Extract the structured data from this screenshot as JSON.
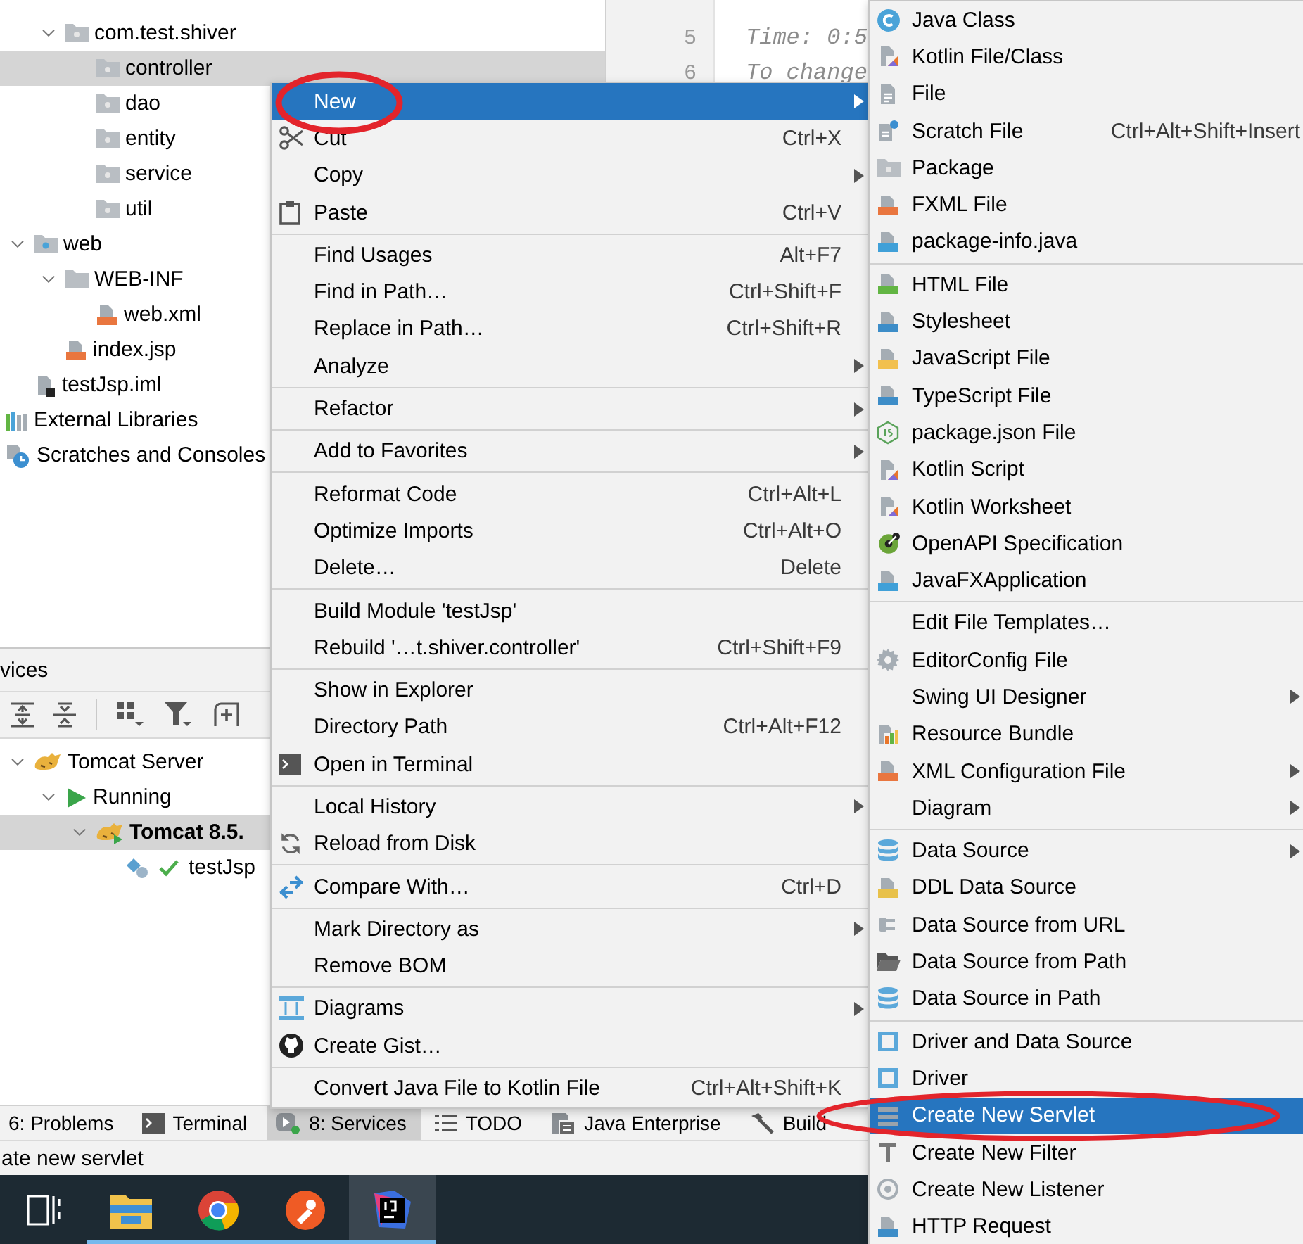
{
  "editor": {
    "line_numbers": [
      "5",
      "6"
    ],
    "lines": [
      "Time: 0:5",
      "To change"
    ]
  },
  "project_tree": {
    "items": [
      {
        "children": [
          {
            "label": "com.test.shiver",
            "kind": "package",
            "expanded": true,
            "selected": false,
            "children": [
              {
                "label": "controller",
                "kind": "package",
                "selected": true
              },
              {
                "label": "dao",
                "kind": "package",
                "selected": false
              },
              {
                "label": "entity",
                "kind": "package",
                "selected": false
              },
              {
                "label": "service",
                "kind": "package",
                "selected": false
              },
              {
                "label": "util",
                "kind": "package",
                "selected": false
              }
            ]
          }
        ]
      },
      {
        "label": "web",
        "kind": "web-folder",
        "expanded": true,
        "selected": false,
        "children": [
          {
            "label": "WEB-INF",
            "kind": "folder",
            "expanded": true,
            "selected": false,
            "children": [
              {
                "label": "web.xml",
                "kind": "xml",
                "selected": false
              }
            ]
          },
          {
            "label": "index.jsp",
            "kind": "jsp",
            "selected": false
          }
        ]
      },
      {
        "label": "testJsp.iml",
        "kind": "iml",
        "selected": false
      }
    ],
    "roots": [
      {
        "label": "External Libraries",
        "kind": "libraries",
        "selected": false
      },
      {
        "label": "Scratches and Consoles",
        "kind": "scratches",
        "selected": false
      }
    ]
  },
  "services": {
    "title": "vices",
    "tree": [
      {
        "label": "Tomcat Server",
        "kind": "tomcat",
        "expanded": true,
        "selected": false,
        "children": [
          {
            "label": "Running",
            "kind": "run",
            "expanded": true,
            "selected": false,
            "children": [
              {
                "label": "Tomcat 8.5.",
                "kind": "tomcat-run",
                "expanded": true,
                "selected": true,
                "bold": true,
                "children": [
                  {
                    "label": "testJsp",
                    "kind": "artifact",
                    "selected": false
                  }
                ]
              }
            ]
          }
        ]
      }
    ]
  },
  "tool_tabs": [
    {
      "label": "6: Problems",
      "kind": "none",
      "selected": false
    },
    {
      "label": "Terminal",
      "kind": "terminal",
      "selected": false
    },
    {
      "label": "8: Services",
      "kind": "services",
      "selected": true
    },
    {
      "label": "TODO",
      "kind": "todo",
      "selected": false
    },
    {
      "label": "Java Enterprise",
      "kind": "java-ee",
      "selected": false
    },
    {
      "label": "Build",
      "kind": "build",
      "selected": false
    }
  ],
  "status_bar": {
    "text": "ate new servlet"
  },
  "taskbar": {
    "apps": [
      {
        "selected": false
      },
      {
        "selected": false
      },
      {
        "selected": false
      },
      {
        "selected": true
      }
    ]
  },
  "context_menu": {
    "groups": [
      {
        "items": [
          {
            "label": "New",
            "kind": "none",
            "submenu": true,
            "selected": true,
            "circled": true
          },
          {
            "label": "Cut",
            "kind": "scissors",
            "shortcut": "Ctrl+X",
            "selected": false
          },
          {
            "label": "Copy",
            "kind": "none",
            "submenu": true,
            "selected": false
          },
          {
            "label": "Paste",
            "kind": "paste",
            "shortcut": "Ctrl+V",
            "selected": false
          }
        ]
      },
      {
        "items": [
          {
            "label": "Find Usages",
            "kind": "none",
            "shortcut": "Alt+F7",
            "selected": false
          },
          {
            "label": "Find in Path…",
            "kind": "none",
            "shortcut": "Ctrl+Shift+F",
            "selected": false
          },
          {
            "label": "Replace in Path…",
            "kind": "none",
            "shortcut": "Ctrl+Shift+R",
            "selected": false
          },
          {
            "label": "Analyze",
            "kind": "none",
            "submenu": true,
            "selected": false
          }
        ]
      },
      {
        "items": [
          {
            "label": "Refactor",
            "kind": "none",
            "submenu": true,
            "selected": false
          }
        ]
      },
      {
        "items": [
          {
            "label": "Add to Favorites",
            "kind": "none",
            "submenu": true,
            "selected": false
          }
        ]
      },
      {
        "items": [
          {
            "label": "Reformat Code",
            "kind": "none",
            "shortcut": "Ctrl+Alt+L",
            "selected": false
          },
          {
            "label": "Optimize Imports",
            "kind": "none",
            "shortcut": "Ctrl+Alt+O",
            "selected": false
          },
          {
            "label": "Delete…",
            "kind": "none",
            "shortcut": "Delete",
            "selected": false
          }
        ]
      },
      {
        "items": [
          {
            "label": "Build Module 'testJsp'",
            "kind": "none",
            "selected": false
          },
          {
            "label": "Rebuild '…t.shiver.controller'",
            "kind": "none",
            "shortcut": "Ctrl+Shift+F9",
            "selected": false
          }
        ]
      },
      {
        "items": [
          {
            "label": "Show in Explorer",
            "kind": "none",
            "selected": false
          },
          {
            "label": "Directory Path",
            "kind": "none",
            "shortcut": "Ctrl+Alt+F12",
            "selected": false
          },
          {
            "label": "Open in Terminal",
            "kind": "terminal",
            "selected": false
          }
        ]
      },
      {
        "items": [
          {
            "label": "Local History",
            "kind": "none",
            "submenu": true,
            "selected": false
          },
          {
            "label": "Reload from Disk",
            "kind": "reload",
            "selected": false
          }
        ]
      },
      {
        "items": [
          {
            "label": "Compare With…",
            "kind": "compare",
            "shortcut": "Ctrl+D",
            "selected": false
          }
        ]
      },
      {
        "items": [
          {
            "label": "Mark Directory as",
            "kind": "none",
            "submenu": true,
            "selected": false
          },
          {
            "label": "Remove BOM",
            "kind": "none",
            "selected": false
          }
        ]
      },
      {
        "items": [
          {
            "label": "Diagrams",
            "kind": "diagrams",
            "submenu": true,
            "selected": false
          },
          {
            "label": "Create Gist…",
            "kind": "github",
            "selected": false
          }
        ]
      },
      {
        "items": [
          {
            "label": "Convert Java File to Kotlin File",
            "kind": "none",
            "shortcut": "Ctrl+Alt+Shift+K",
            "selected": false
          }
        ]
      }
    ]
  },
  "new_submenu": {
    "groups": [
      {
        "items": [
          {
            "label": "Java Class",
            "kind": "class",
            "selected": false
          },
          {
            "label": "Kotlin File/Class",
            "kind": "kotlin",
            "selected": false
          },
          {
            "label": "File",
            "kind": "file",
            "selected": false
          },
          {
            "label": "Scratch File",
            "kind": "scratch",
            "shortcut": "Ctrl+Alt+Shift+Insert",
            "selected": false
          },
          {
            "label": "Package",
            "kind": "package",
            "selected": false
          },
          {
            "label": "FXML File",
            "kind": "xml",
            "selected": false
          },
          {
            "label": "package-info.java",
            "kind": "java",
            "selected": false
          }
        ]
      },
      {
        "items": [
          {
            "label": "HTML File",
            "kind": "html",
            "selected": false
          },
          {
            "label": "Stylesheet",
            "kind": "css",
            "selected": false
          },
          {
            "label": "JavaScript File",
            "kind": "js",
            "selected": false
          },
          {
            "label": "TypeScript File",
            "kind": "ts",
            "selected": false
          },
          {
            "label": "package.json File",
            "kind": "nodejs",
            "selected": false
          },
          {
            "label": "Kotlin Script",
            "kind": "kotlin",
            "selected": false
          },
          {
            "label": "Kotlin Worksheet",
            "kind": "kotlin",
            "selected": false
          },
          {
            "label": "OpenAPI Specification",
            "kind": "openapi",
            "selected": false
          },
          {
            "label": "JavaFXApplication",
            "kind": "java",
            "selected": false
          }
        ]
      },
      {
        "items": [
          {
            "label": "Edit File Templates…",
            "kind": "none",
            "selected": false
          },
          {
            "label": "EditorConfig File",
            "kind": "gear",
            "selected": false
          },
          {
            "label": "Swing UI Designer",
            "kind": "none",
            "submenu": true,
            "selected": false
          },
          {
            "label": "Resource Bundle",
            "kind": "bundle",
            "selected": false
          },
          {
            "label": "XML Configuration File",
            "kind": "xml",
            "submenu": true,
            "selected": false
          },
          {
            "label": "Diagram",
            "kind": "none",
            "submenu": true,
            "selected": false
          }
        ]
      },
      {
        "items": [
          {
            "label": "Data Source",
            "kind": "db",
            "submenu": true,
            "selected": false
          },
          {
            "label": "DDL Data Source",
            "kind": "ddl",
            "selected": false
          },
          {
            "label": "Data Source from URL",
            "kind": "url",
            "selected": false
          },
          {
            "label": "Data Source from Path",
            "kind": "folder-open",
            "selected": false
          },
          {
            "label": "Data Source in Path",
            "kind": "db",
            "selected": false
          }
        ]
      },
      {
        "items": [
          {
            "label": "Driver and Data Source",
            "kind": "driver",
            "selected": false
          },
          {
            "label": "Driver",
            "kind": "driver",
            "selected": false
          },
          {
            "label": "Create New Servlet",
            "kind": "servlet",
            "selected": true,
            "circled": true
          },
          {
            "label": "Create New Filter",
            "kind": "filter",
            "selected": false
          },
          {
            "label": "Create New Listener",
            "kind": "listener",
            "selected": false
          },
          {
            "label": "HTTP Request",
            "kind": "api",
            "selected": false
          }
        ]
      }
    ]
  }
}
